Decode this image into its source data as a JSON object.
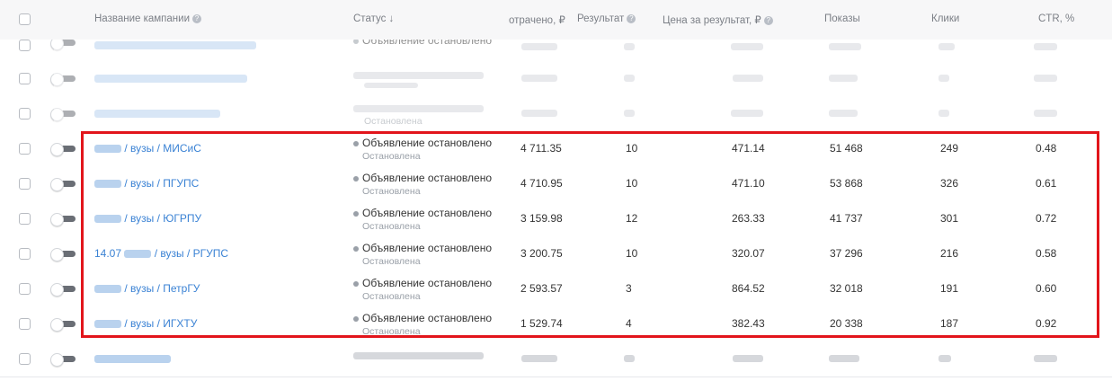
{
  "header": {
    "name": "Название кампании",
    "status": "Статус ↓",
    "spent": "отрачено, ₽",
    "result": "Результат",
    "price": "Цена за результат, ₽",
    "impressions": "Показы",
    "clicks": "Клики",
    "ctr": "CTR, %"
  },
  "blurred_rows": [
    {
      "status": "Объявление остановлено"
    },
    {
      "status": ""
    },
    {
      "status": "",
      "sub": "Остановлена"
    },
    {
      "status": ""
    }
  ],
  "rows": [
    {
      "name": " / вузы / МИСиС",
      "status": "Объявление остановлено",
      "sub": "Остановлена",
      "spent": "4 711.35",
      "result": "10",
      "price": "471.14",
      "impressions": "51 468",
      "clicks": "249",
      "ctr": "0.48"
    },
    {
      "name": " / вузы / ПГУПС",
      "status": "Объявление остановлено",
      "sub": "Остановлена",
      "spent": "4 710.95",
      "result": "10",
      "price": "471.10",
      "impressions": "53 868",
      "clicks": "326",
      "ctr": "0.61"
    },
    {
      "name": " / вузы / ЮГРПУ",
      "status": "Объявление остановлено",
      "sub": "Остановлена",
      "spent": "3 159.98",
      "result": "12",
      "price": "263.33",
      "impressions": "41 737",
      "clicks": "301",
      "ctr": "0.72"
    },
    {
      "name_prefix": "14.07",
      "name": " / вузы / РГУПС",
      "status": "Объявление остановлено",
      "sub": "Остановлена",
      "spent": "3 200.75",
      "result": "10",
      "price": "320.07",
      "impressions": "37 296",
      "clicks": "216",
      "ctr": "0.58"
    },
    {
      "name": " / вузы / ПетрГУ",
      "status": "Объявление остановлено",
      "sub": "Остановлена",
      "spent": "2 593.57",
      "result": "3",
      "price": "864.52",
      "impressions": "32 018",
      "clicks": "191",
      "ctr": "0.60"
    },
    {
      "name": " / вузы / ИГХТУ",
      "status": "Объявление остановлено",
      "sub": "Остановлена",
      "spent": "1 529.74",
      "result": "4",
      "price": "382.43",
      "impressions": "20 338",
      "clicks": "187",
      "ctr": "0.92"
    }
  ],
  "highlight_color": "#e2151b"
}
